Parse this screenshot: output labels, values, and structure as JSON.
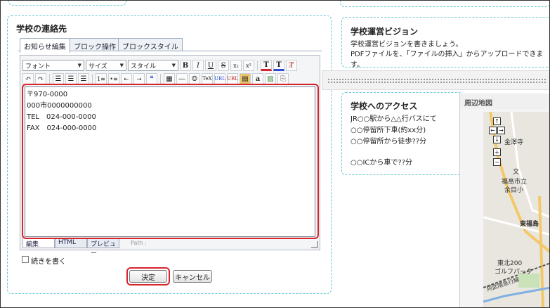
{
  "contact_block": {
    "title": "学校の連絡先",
    "tabs": [
      "お知らせ編集",
      "ブロック操作",
      "ブロックスタイル"
    ],
    "toolbar": {
      "font_select": "フォント",
      "size_select": "サイズ",
      "style_select": "スタイル"
    },
    "content_lines": [
      "〒970-0000",
      "000市0000000000",
      "TEL　024-000-0000",
      "FAX　024-000-0000"
    ],
    "modes": [
      "編集",
      "HTML",
      "プレビュー"
    ],
    "path_label": "Path :",
    "continue_label": "続きを書く",
    "ok_label": "決定",
    "cancel_label": "キャンセル"
  },
  "vision_block": {
    "title": "学校運営ビジョン",
    "lines": [
      "学校運営ビジョンを書きましょう。",
      "PDFファイルを、「ファイルの挿入」からアップロードできます。"
    ]
  },
  "access_block": {
    "title": "学校へのアクセス",
    "lines": [
      "JR○○駅から△△行バスにて",
      "○○停留所下車(約xx分)",
      "○○停留所から徒歩??分",
      "",
      "○○ICから車で??分"
    ]
  },
  "map_block": {
    "title": "周辺地図",
    "labels": [
      "金澤寺",
      "文",
      "福島市立",
      "余目小",
      "東福島",
      "東北200",
      "ゴルフパーク",
      "阿武隈急行線"
    ]
  },
  "colors": {
    "dash_border": "#6cc7d9",
    "highlight_red": "#d9232d"
  }
}
